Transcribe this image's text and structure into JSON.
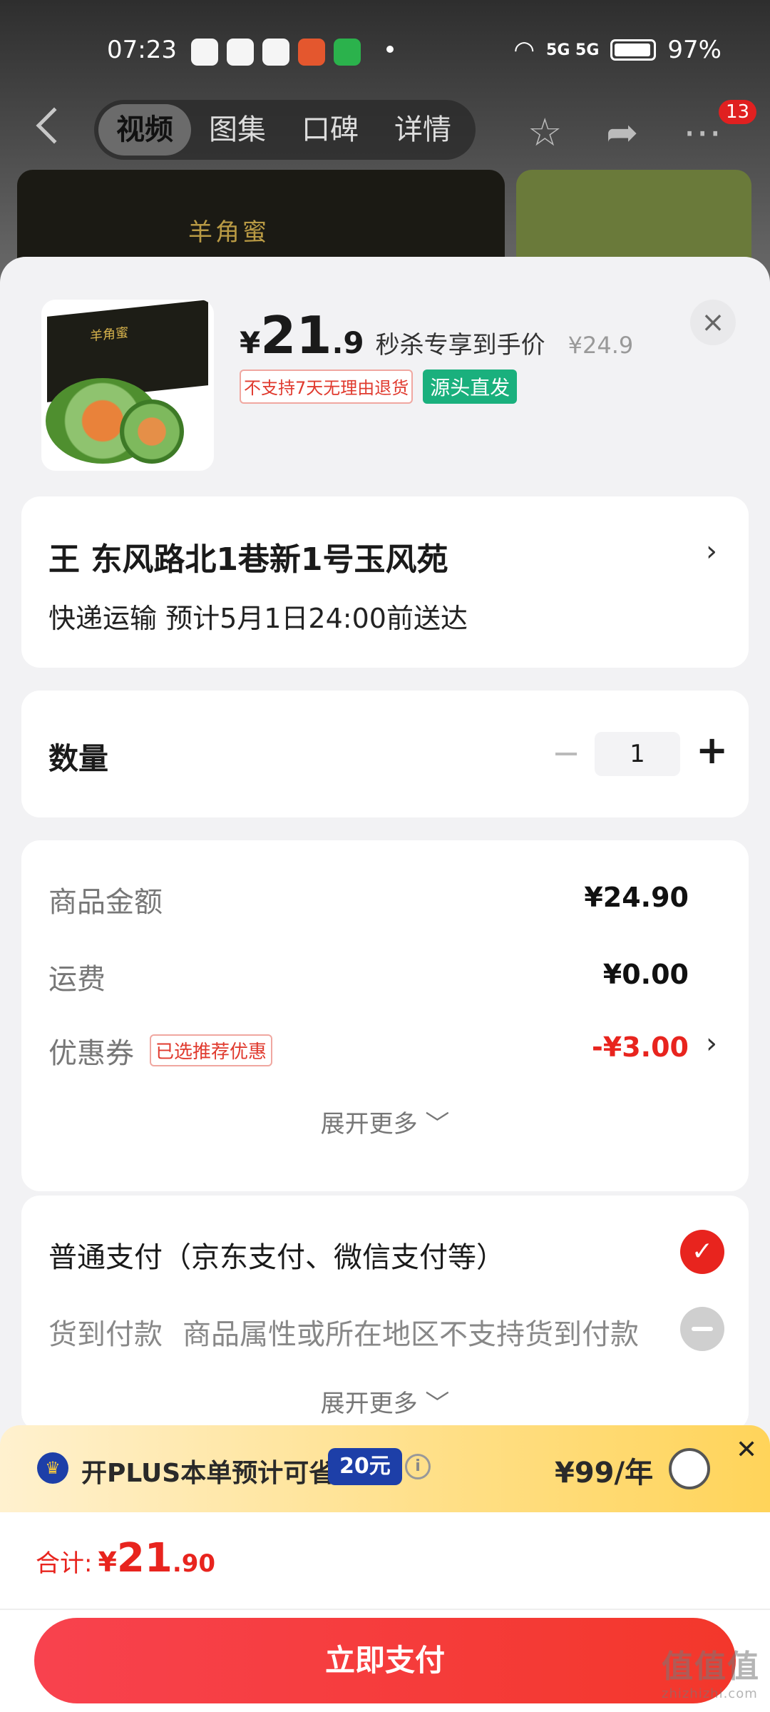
{
  "status_bar": {
    "time": "07:23",
    "network": "5G 5G",
    "battery": "97%"
  },
  "nav": {
    "tabs": [
      "视频",
      "图集",
      "口碑",
      "详情"
    ],
    "active_tab": "视频",
    "badge_count": "13",
    "bg_box_text": "羊角蜜"
  },
  "product": {
    "box_text": "羊角蜜",
    "price_yen": "¥",
    "price_int": "21",
    "price_dec": ".9",
    "price_desc": "秒杀专享到手价",
    "original_price": "¥24.9",
    "tag_no_return": "不支持7天无理由退货",
    "tag_source": "源头直发"
  },
  "address": {
    "line1": "王  东风路北1巷新1号玉风苑",
    "line2": "快递运输 预计5月1日24:00前送达"
  },
  "quantity": {
    "label": "数量",
    "minus": "−",
    "value": "1",
    "plus": "+"
  },
  "cost": {
    "goods_label": "商品金额",
    "goods_value": "¥24.90",
    "shipping_label": "运费",
    "shipping_value": "¥0.00",
    "coupon_label": "优惠券",
    "coupon_tag": "已选推荐优惠",
    "coupon_value": "-¥3.00",
    "expand": "展开更多 ﹀"
  },
  "payment": {
    "option1": "普通支付（京东支付、微信支付等）",
    "option2": "货到付款",
    "option2_note": "商品属性或所在地区不支持货到付款",
    "expand": "展开更多 ﹀"
  },
  "plus": {
    "text": "开PLUS本单预计可省",
    "save": "20元",
    "price": "¥99/年"
  },
  "summary": {
    "total_label": "合计:",
    "total_yen": "¥",
    "total_int": "21",
    "total_dec": ".90",
    "pay_button": "立即支付"
  },
  "watermark": {
    "text": "值值值",
    "url": "zhizhizhi.com"
  },
  "colors": {
    "accent_red": "#e8241e",
    "green_tag": "#1ab07d",
    "plus_blue": "#1d3fa8"
  },
  "icons": [
    "back-icon",
    "star-icon",
    "share-icon",
    "more-icon",
    "close-icon",
    "chevron-right-icon",
    "check-icon",
    "disabled-icon",
    "crown-icon",
    "info-icon"
  ]
}
